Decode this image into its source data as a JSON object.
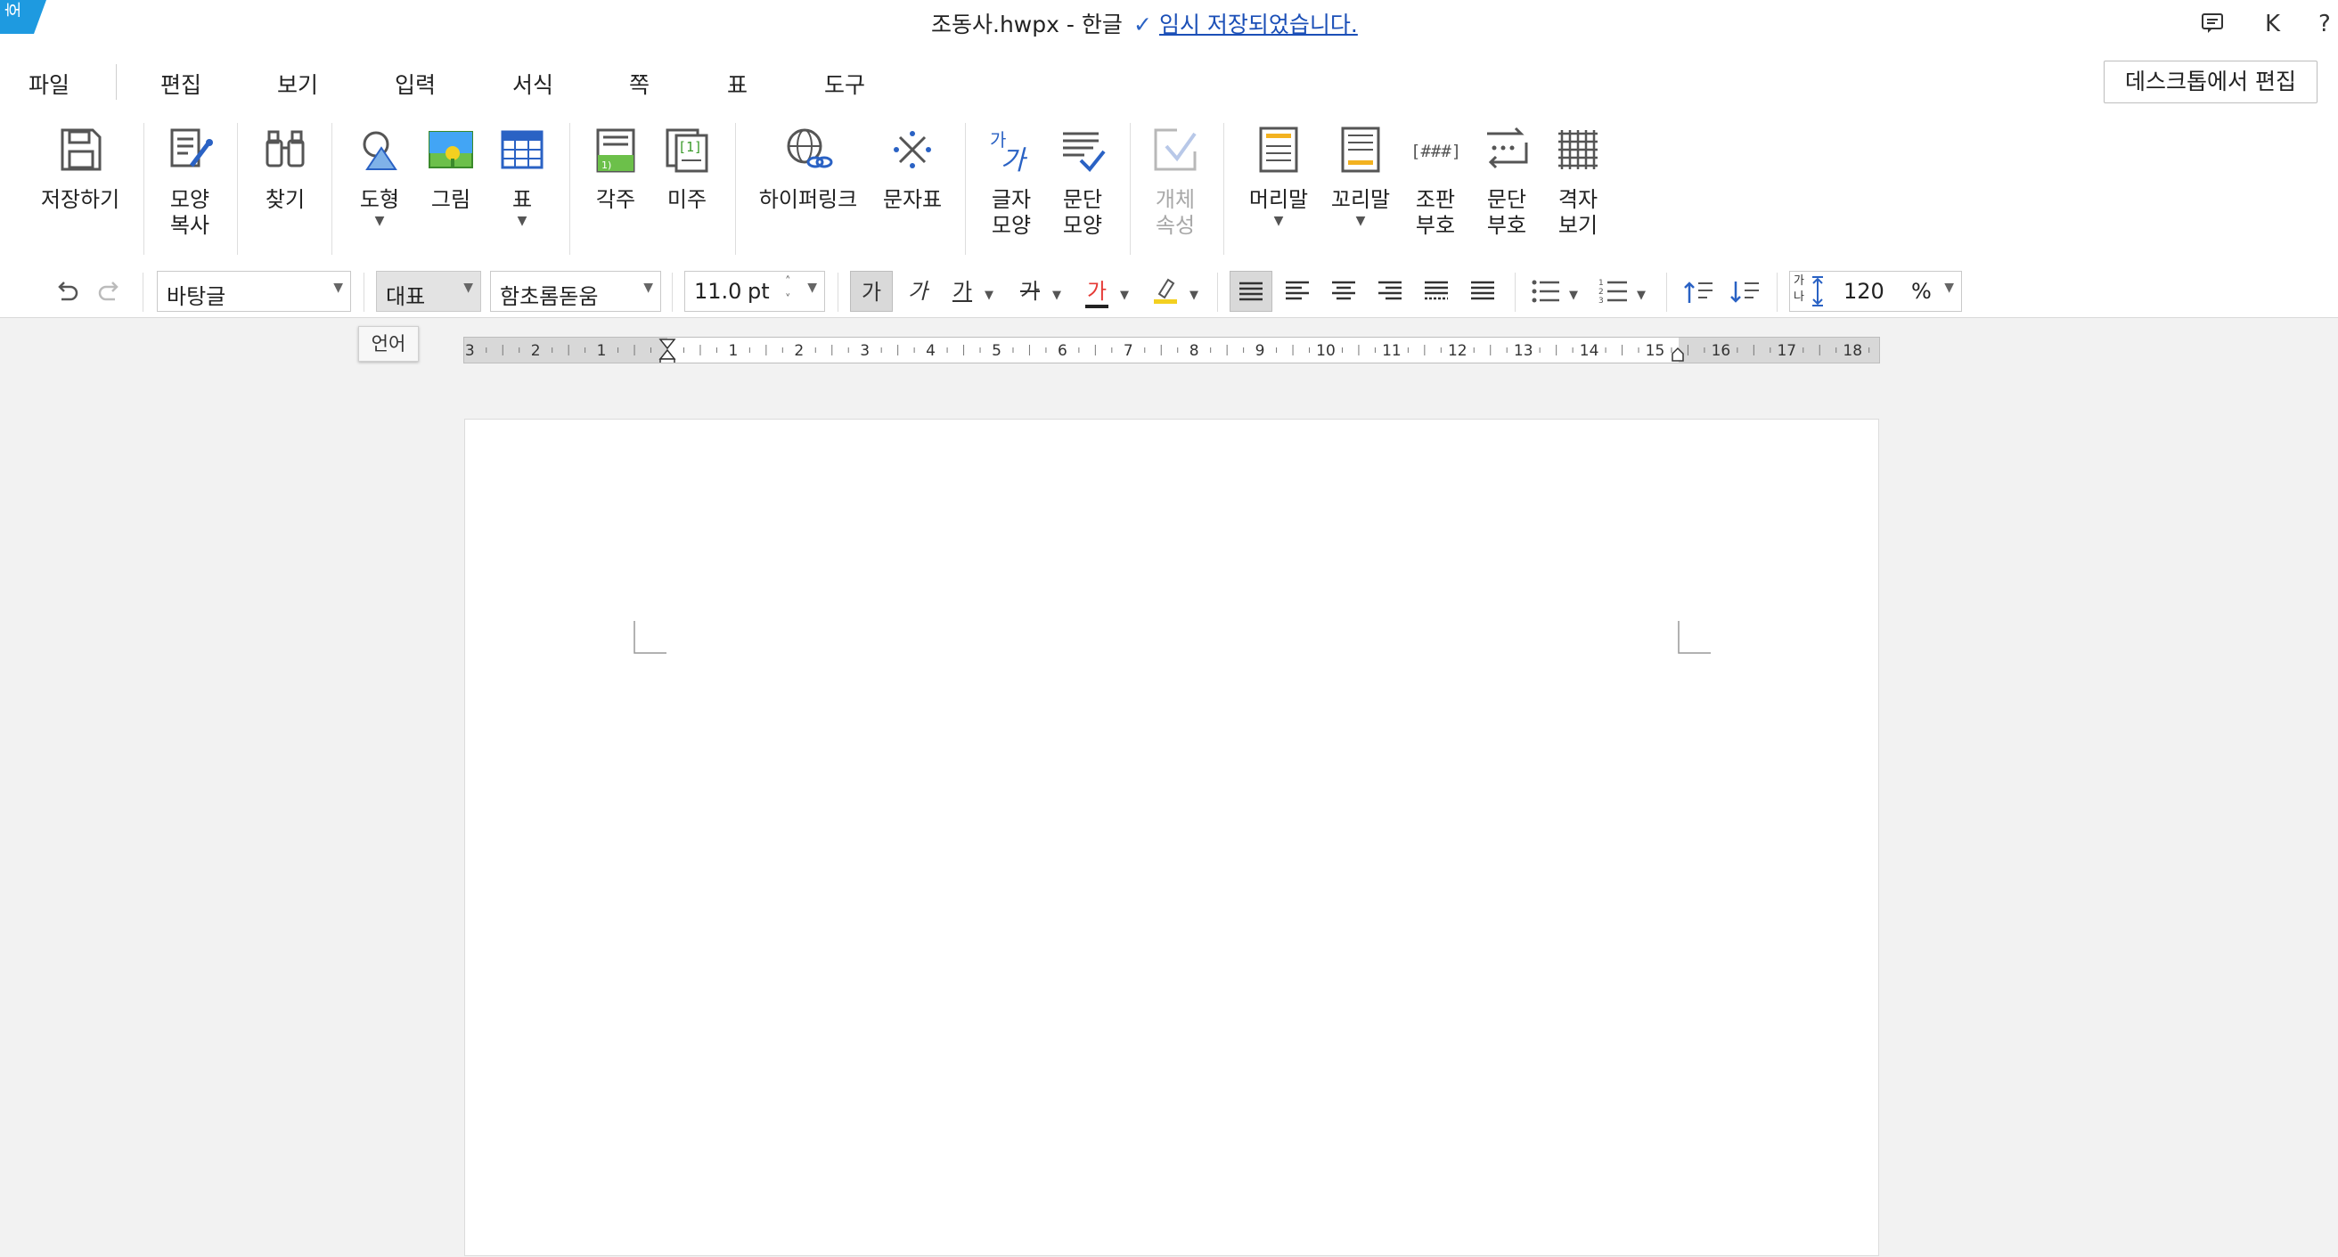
{
  "logo": {
    "glyph": "호"
  },
  "titlebar": {
    "doc_title": "조동사.hwpx - 한글",
    "save_status": "임시 저장되었습니다.",
    "comment_icon": "comment-icon",
    "user_initial": "K",
    "help": "?"
  },
  "menu": [
    "파일",
    "편집",
    "보기",
    "입력",
    "서식",
    "쪽",
    "표",
    "도구"
  ],
  "desktop_edit": "데스크톱에서 편집",
  "ribbon": [
    {
      "label": "저장하기",
      "icon": "save-icon"
    },
    {
      "label": "모양\n복사",
      "icon": "format-painter-icon"
    },
    {
      "label": "찾기",
      "icon": "binoculars-icon"
    },
    {
      "label": "도형",
      "icon": "shape-icon"
    },
    {
      "label": "그림",
      "icon": "picture-icon"
    },
    {
      "label": "표",
      "icon": "table-icon"
    },
    {
      "label": "각주",
      "icon": "footnote-icon"
    },
    {
      "label": "미주",
      "icon": "endnote-icon"
    },
    {
      "label": "하이퍼링크",
      "icon": "hyperlink-icon"
    },
    {
      "label": "문자표",
      "icon": "symbol-icon"
    },
    {
      "label": "글자\n모양",
      "icon": "char-shape-icon"
    },
    {
      "label": "문단\n모양",
      "icon": "para-shape-icon"
    },
    {
      "label": "개체\n속성",
      "icon": "object-props-icon"
    },
    {
      "label": "머리말",
      "icon": "header-icon"
    },
    {
      "label": "꼬리말",
      "icon": "footer-icon"
    },
    {
      "label": "조판\n부호",
      "icon": "control-codes-icon"
    },
    {
      "label": "문단\n부호",
      "icon": "para-marks-icon"
    },
    {
      "label": "격자\n보기",
      "icon": "grid-icon"
    }
  ],
  "format": {
    "style": "바탕글",
    "language": "대표",
    "font": "함초롬돋움",
    "size": "11.0",
    "unit": "pt",
    "bold": "가",
    "italic": "가",
    "underline": "가",
    "strike": "가",
    "font_color_glyph": "가",
    "line_spacing": "120",
    "line_spacing_unit": "%",
    "line_spacing_glyph": "가\n나"
  },
  "tooltip": "언어",
  "ruler": {
    "labels": [
      "3",
      "2",
      "1",
      "1",
      "2",
      "3",
      "4",
      "5",
      "6",
      "7",
      "8",
      "9",
      "10",
      "11",
      "12",
      "13",
      "14",
      "15",
      "16",
      "17",
      "18"
    ]
  },
  "colors": {
    "accent": "#1b4fb7",
    "logo_bg": "#1e9ae0",
    "font_color_bar": "#e53935",
    "highlight_bar": "#f3d020"
  }
}
